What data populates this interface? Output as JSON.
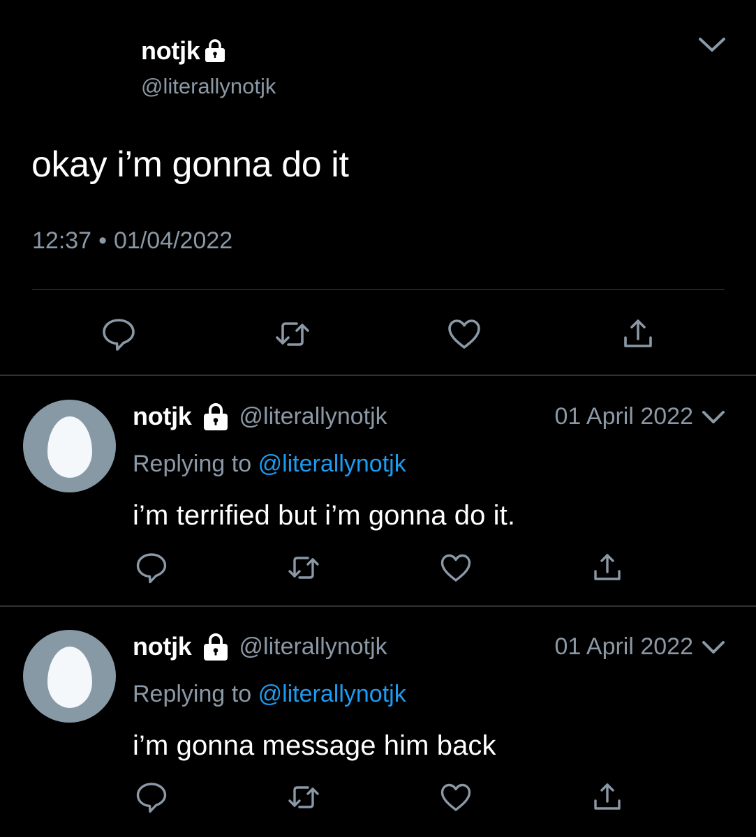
{
  "main_tweet": {
    "display_name": "notjk",
    "handle": "@literallynotjk",
    "text": "okay i’m gonna do it",
    "time": "12:37",
    "separator": "•",
    "date": "01/04/2022"
  },
  "replies": [
    {
      "display_name": "notjk",
      "handle": "@literallynotjk",
      "date": "01 April 2022",
      "replying_label": "Replying to",
      "replying_to": "@literallynotjk",
      "text": "i’m terrified but i’m gonna do it."
    },
    {
      "display_name": "notjk",
      "handle": "@literallynotjk",
      "date": "01 April 2022",
      "replying_label": "Replying to",
      "replying_to": "@literallynotjk",
      "text": "i’m gonna message him back"
    }
  ],
  "icons": {
    "reply": "reply-icon",
    "retweet": "retweet-icon",
    "like": "like-icon",
    "share": "share-icon",
    "lock": "lock-icon",
    "chevron": "chevron-down-icon"
  },
  "colors": {
    "background": "#000000",
    "primary_text": "#ffffff",
    "secondary_text": "#8b98a5",
    "link": "#1d9bf0",
    "divider": "#2f3336",
    "avatar_bg": "#8899a6",
    "avatar_egg": "#f5f8fa"
  }
}
